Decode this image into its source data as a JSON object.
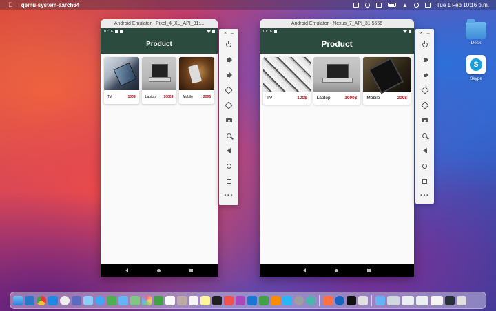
{
  "menubar": {
    "app_name": "qemu-system-aarch64",
    "datetime": "Tue 1 Feb  10:16 p.m."
  },
  "emulators": [
    {
      "title": "Android Emulator - Pixel_4_XL_API_31:...",
      "clock": "10:16",
      "appbar_title": "Product",
      "products": [
        {
          "name": "TV",
          "price": "100$",
          "image": "tablet-on-desk-photo"
        },
        {
          "name": "Laptop",
          "price": "1000$",
          "image": "laptop-photo"
        },
        {
          "name": "Mobile",
          "price": "200$",
          "image": "phone-in-hand-photo"
        }
      ]
    },
    {
      "title": "Android Emulator - Nexus_7_API_31:5556",
      "clock": "10:16",
      "appbar_title": "Product",
      "products": [
        {
          "name": "TV",
          "price": "100$",
          "image": "gadgets-flatlay-photo"
        },
        {
          "name": "Laptop",
          "price": "1000$",
          "image": "laptop-photo"
        },
        {
          "name": "Mobile",
          "price": "200$",
          "image": "tablet-photo"
        }
      ]
    }
  ],
  "toolbar": {
    "close": "×",
    "minimize": "–",
    "buttons": [
      "power-icon",
      "volume-up-icon",
      "volume-down-icon",
      "rotate-left-icon",
      "rotate-right-icon",
      "camera-icon",
      "zoom-icon",
      "back-icon",
      "home-icon",
      "overview-icon",
      "more-icon"
    ],
    "more": "•••"
  },
  "desktop": {
    "icons": [
      {
        "label": "Desk",
        "icon": "folder-icon"
      },
      {
        "label": "Skype",
        "icon": "skype-icon",
        "glyph": "S"
      }
    ]
  },
  "colors": {
    "appbar": "#2c4b3f",
    "price": "#c0141e",
    "navbar": "#000000"
  },
  "dock": {
    "apps": [
      "finder-icon",
      "vscode-icon",
      "chrome-icon",
      "appstore-icon",
      "safari-icon",
      "launchpad-icon",
      "xcode-icon",
      "safari-compass-icon",
      "messages-icon",
      "mail-icon",
      "maps-icon",
      "photos-icon",
      "facetime-icon",
      "calendar-icon",
      "contacts-icon",
      "reminders-icon",
      "notes-icon",
      "tv-icon",
      "music-icon",
      "podcasts-icon",
      "keynote-icon",
      "numbers-icon",
      "pages-icon",
      "appstore-store-icon",
      "settings-icon",
      "android-studio-icon",
      "swift-icon",
      "word-icon",
      "terminal-icon",
      "git-icon",
      "downloads-folder-icon",
      "window-thumb-icon",
      "window-thumb-icon",
      "window-thumb-icon",
      "window-thumb-icon",
      "trash-icon"
    ]
  }
}
